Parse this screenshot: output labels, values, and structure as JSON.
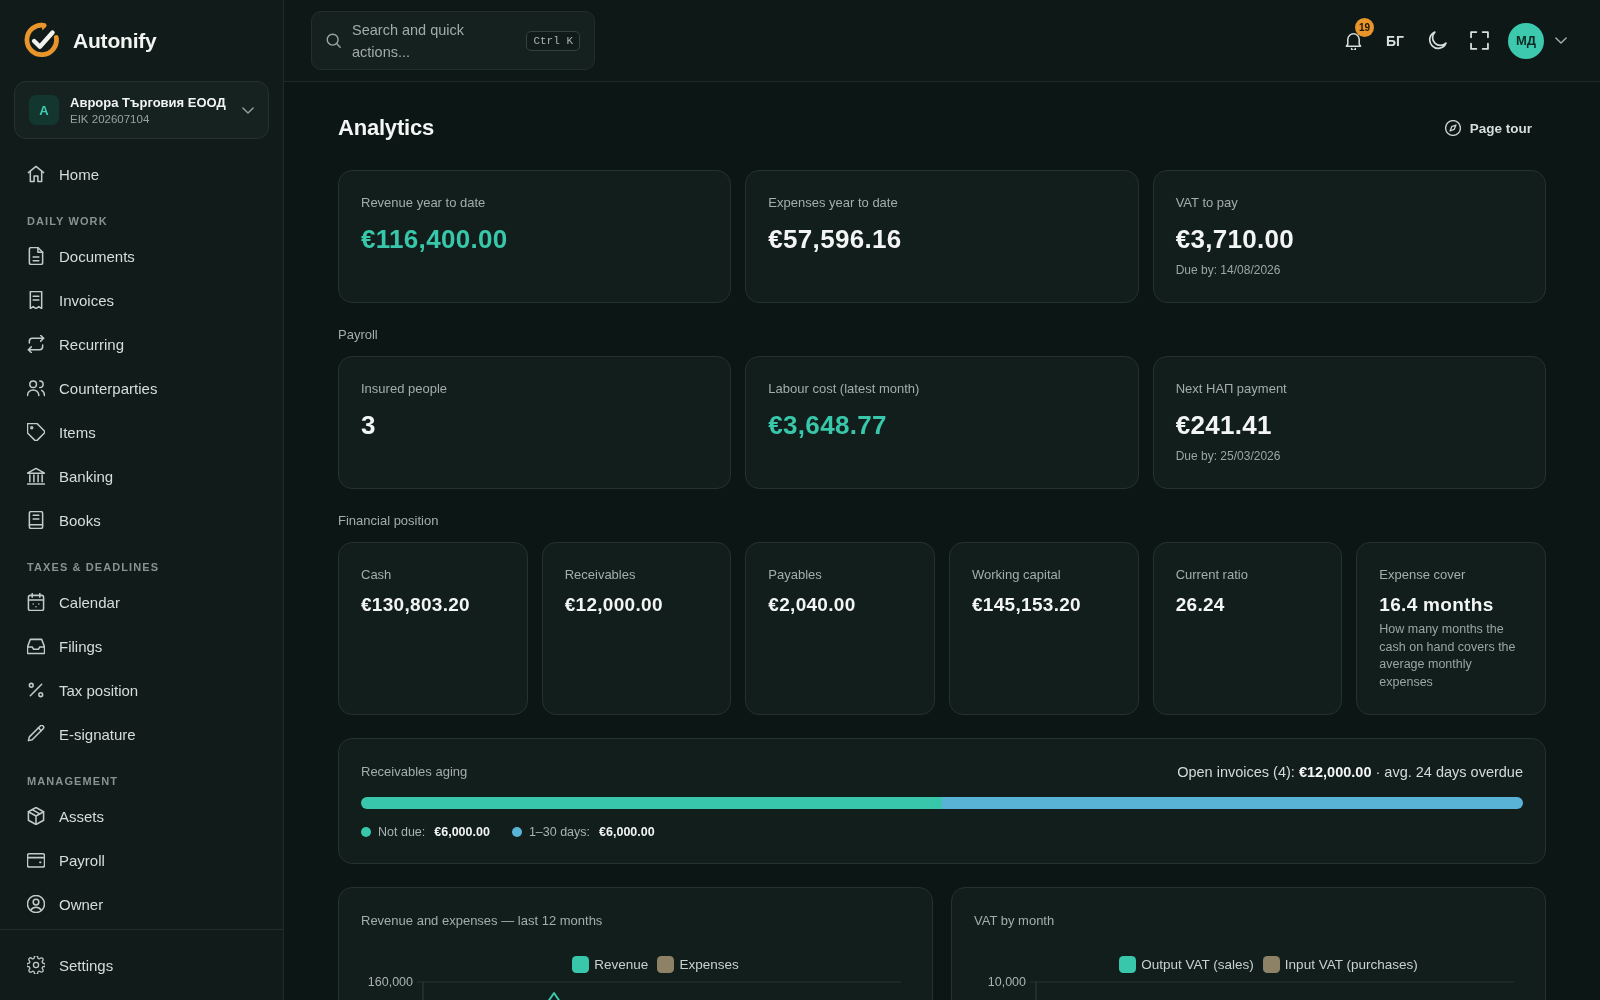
{
  "brand": {
    "name": "Autonify"
  },
  "company": {
    "avatar": "A",
    "name": "Аврора Търговия ЕООД",
    "id": "EIK 202607104"
  },
  "sidebar": {
    "sections": [
      {
        "items": [
          {
            "label": "Home",
            "selected": false
          }
        ]
      },
      {
        "heading": "DAILY WORK",
        "items": [
          {
            "label": "Documents",
            "selected": false
          },
          {
            "label": "Invoices",
            "selected": false
          },
          {
            "label": "Recurring",
            "selected": false
          },
          {
            "label": "Counterparties",
            "selected": false
          },
          {
            "label": "Items",
            "selected": false
          },
          {
            "label": "Banking",
            "selected": false
          },
          {
            "label": "Books",
            "selected": false
          }
        ]
      },
      {
        "heading": "TAXES & DEADLINES",
        "items": [
          {
            "label": "Calendar",
            "selected": false
          },
          {
            "label": "Filings",
            "selected": false
          },
          {
            "label": "Tax position",
            "selected": false
          },
          {
            "label": "E-signature",
            "selected": false
          }
        ]
      },
      {
        "heading": "MANAGEMENT",
        "items": [
          {
            "label": "Assets",
            "selected": false
          },
          {
            "label": "Payroll",
            "selected": false
          },
          {
            "label": "Owner",
            "selected": false
          }
        ]
      }
    ],
    "footer_items": [
      {
        "label": "Settings",
        "selected": false
      }
    ]
  },
  "topbar": {
    "search": {
      "placeholder": "Search and quick actions...",
      "shortcut": "Ctrl K"
    },
    "notifications": {
      "count": "19"
    },
    "language": "БГ",
    "user": {
      "initials": "МД"
    }
  },
  "page": {
    "title": "Analytics",
    "tour": "Page tour"
  },
  "summary_cards": [
    {
      "label": "Revenue year to date",
      "value": "€116,400.00",
      "accent": true
    },
    {
      "label": "Expenses year to date",
      "value": "€57,596.16",
      "accent": false
    },
    {
      "label": "VAT to pay",
      "value": "€3,710.00",
      "accent": false,
      "note": "Due by: 14/08/2026"
    }
  ],
  "payroll": {
    "heading": "Payroll",
    "cards": [
      {
        "label": "Insured people",
        "value": "3",
        "accent": false
      },
      {
        "label": "Labour cost (latest month)",
        "value": "€3,648.77",
        "accent": true
      },
      {
        "label": "Next НАП payment",
        "value": "€241.41",
        "accent": false,
        "note": "Due by: 25/03/2026"
      }
    ]
  },
  "financial_position": {
    "heading": "Financial position",
    "cards": [
      {
        "label": "Cash",
        "value": "€130,803.20",
        "accent": false
      },
      {
        "label": "Receivables",
        "value": "€12,000.00",
        "accent": false
      },
      {
        "label": "Payables",
        "value": "€2,040.00",
        "accent": false
      },
      {
        "label": "Working capital",
        "value": "€145,153.20",
        "accent": false
      },
      {
        "label": "Current ratio",
        "value": "26.24",
        "accent": false
      },
      {
        "label": "Expense cover",
        "value": "16.4 months",
        "accent": false,
        "note": "How many months the cash on hand covers the average monthly expenses"
      }
    ]
  },
  "receivables_aging": {
    "title": "Receivables aging",
    "summary": "Open invoices (4): **€12,000.00** · avg. 24 days overdue",
    "segments": [
      {
        "label": "Not due:",
        "amount": "€6,000.00",
        "level": 0.5,
        "color": "#38c7aa"
      },
      {
        "label": "1–30 days:",
        "amount": "€6,000.00",
        "level": 0.5,
        "color": "#58b3d6"
      }
    ]
  },
  "charts": [
    {
      "kind": "line",
      "title": "Revenue and expenses — last 12 months",
      "legend": [
        {
          "name": "Revenue",
          "color": "#38c7aa"
        },
        {
          "name": "Expenses",
          "color": "#8e8266"
        }
      ],
      "axis_label": "160,000"
    },
    {
      "kind": "bar",
      "title": "VAT by month",
      "legend": [
        {
          "name": "Output VAT (sales)",
          "color": "#38c7aa"
        },
        {
          "name": "Input VAT (purchases)",
          "color": "#8e8266"
        }
      ],
      "axis_label": "10,000"
    }
  ]
}
